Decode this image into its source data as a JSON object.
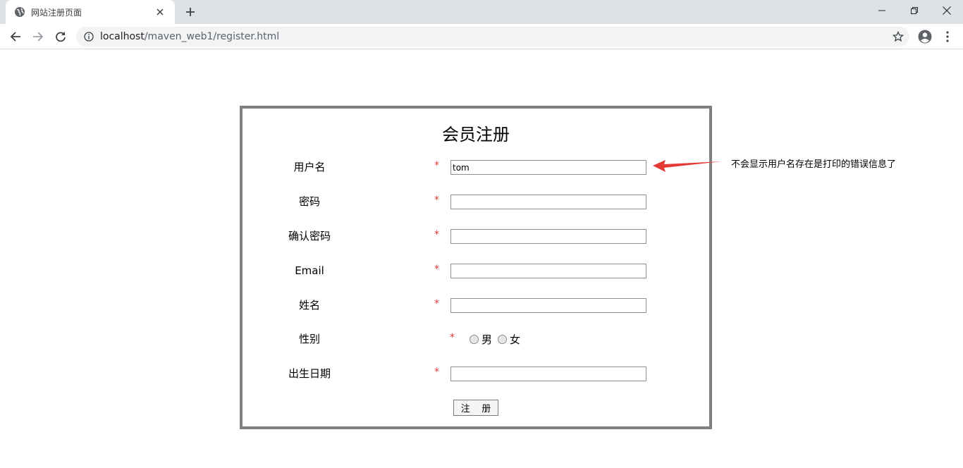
{
  "browser": {
    "tab_title": "网站注册页面",
    "url_host": "localhost",
    "url_path": "/maven_web1/register.html",
    "icons": {
      "favicon": "globe-icon",
      "close": "close-icon",
      "new_tab": "plus-icon",
      "back": "back-arrow-icon",
      "forward": "forward-arrow-icon",
      "reload": "reload-icon",
      "site_info": "info-icon",
      "bookmark": "star-icon",
      "profile": "profile-icon",
      "menu": "kebab-menu-icon"
    }
  },
  "form": {
    "title": "会员注册",
    "required_mark": "*",
    "fields": [
      {
        "label": "用户名",
        "value": "tom"
      },
      {
        "label": "密码",
        "value": ""
      },
      {
        "label": "确认密码",
        "value": ""
      },
      {
        "label": "Email",
        "value": ""
      },
      {
        "label": "姓名",
        "value": ""
      },
      {
        "label": "性别",
        "options": [
          "男",
          "女"
        ]
      },
      {
        "label": "出生日期",
        "value": ""
      }
    ],
    "submit_label": "注    册"
  },
  "annotation": {
    "text": "不会显示用户名存在是打印的错误信息了",
    "arrow_color": "#e53935"
  },
  "colors": {
    "required": "#e53935",
    "form_border": "#808080"
  }
}
